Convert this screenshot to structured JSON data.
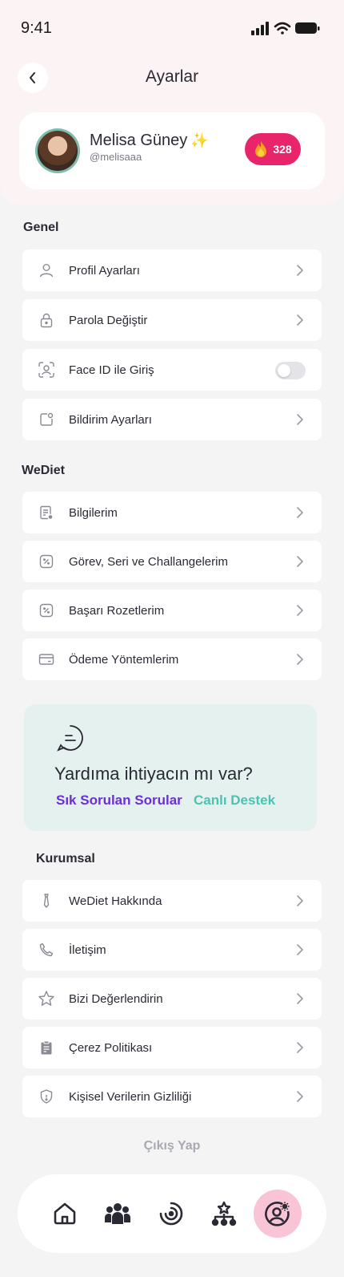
{
  "status_bar": {
    "time": "9:41"
  },
  "header": {
    "title": "Ayarlar"
  },
  "profile": {
    "name": "Melisa Güney",
    "handle": "@melisaaa",
    "streak": "328"
  },
  "sections": {
    "genel": {
      "title": "Genel",
      "items": [
        {
          "label": "Profil Ayarları",
          "icon": "user-icon"
        },
        {
          "label": "Parola Değiştir",
          "icon": "lock-icon"
        },
        {
          "label": "Face ID ile Giriş",
          "icon": "face-id-icon",
          "toggle": false
        },
        {
          "label": "Bildirim Ayarları",
          "icon": "notification-icon"
        }
      ]
    },
    "wediet": {
      "title": "WeDiet",
      "items": [
        {
          "label": "Bilgilerim",
          "icon": "document-icon"
        },
        {
          "label": "Görev, Seri ve Challangelerim",
          "icon": "percent-badge-icon"
        },
        {
          "label": "Başarı Rozetlerim",
          "icon": "percent-badge-icon"
        },
        {
          "label": "Ödeme Yöntemlerim",
          "icon": "card-icon"
        }
      ]
    },
    "kurumsal": {
      "title": "Kurumsal",
      "items": [
        {
          "label": "WeDiet Hakkında",
          "icon": "tie-icon"
        },
        {
          "label": "İletişim",
          "icon": "phone-icon"
        },
        {
          "label": "Bizi Değerlendirin",
          "icon": "star-icon"
        },
        {
          "label": "Çerez Politikası",
          "icon": "clipboard-icon"
        },
        {
          "label": "Kişisel Verilerin Gizliliği",
          "icon": "shield-icon"
        }
      ]
    }
  },
  "help": {
    "title": "Yardıma ihtiyacın mı var?",
    "faq_label": "Sık Sorulan Sorular",
    "support_label": "Canlı Destek"
  },
  "logout_label": "Çıkış Yap",
  "nav": {
    "items": [
      "home-icon",
      "community-icon",
      "progress-icon",
      "hierarchy-icon",
      "settings-profile-icon"
    ],
    "active": "settings-profile-icon"
  },
  "colors": {
    "accent_pink": "#e8246a",
    "faq_purple": "#6a2fd6",
    "support_teal": "#4cc3b0",
    "help_bg": "#e5f1ef"
  }
}
